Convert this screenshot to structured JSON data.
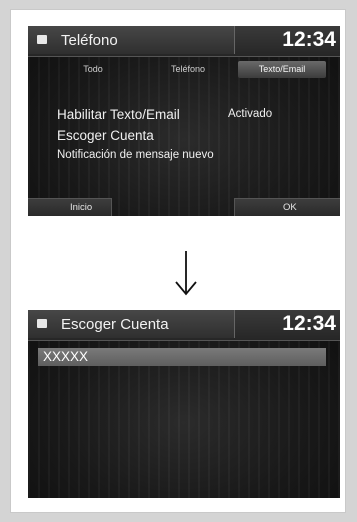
{
  "screen1": {
    "title": "Teléfono",
    "clock": "12:34",
    "tabs": [
      {
        "label": "Todo",
        "active": false
      },
      {
        "label": "Teléfono",
        "active": false
      },
      {
        "label": "Texto/Email",
        "active": true
      }
    ],
    "items": [
      {
        "label": "Habilitar Texto/Email",
        "value": "Activado"
      },
      {
        "label": "Escoger Cuenta"
      },
      {
        "label": "Notificación de mensaje nuevo"
      }
    ],
    "buttons": {
      "left": "Inicio",
      "right": "OK"
    }
  },
  "screen2": {
    "title": "Escoger Cuenta",
    "clock": "12:34",
    "items": [
      {
        "label": "XXXXX",
        "selected": true
      }
    ]
  },
  "colors": {
    "page_bg": "#d4d4d4",
    "screen_bg": "#181818",
    "highlight": "#6c6c6c",
    "text": "#f0f0f0"
  },
  "icons": [
    "phone-icon",
    "down-arrow-icon"
  ]
}
